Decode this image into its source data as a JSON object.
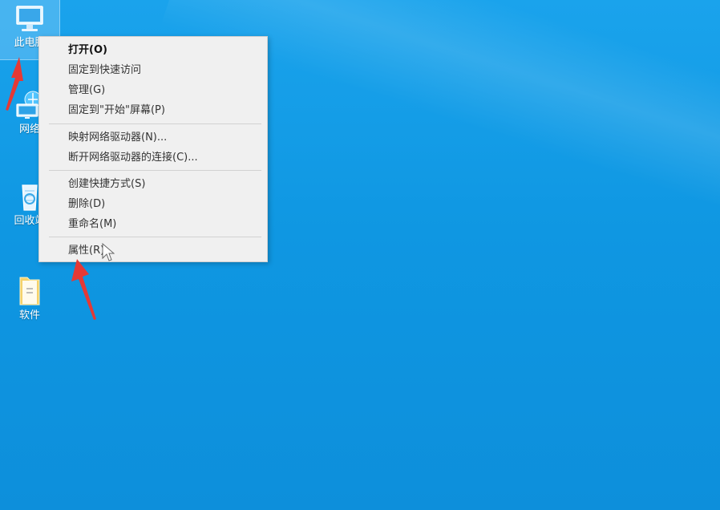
{
  "desktop": {
    "icons": [
      {
        "label": "此电脑",
        "icon": "computer-icon"
      },
      {
        "label": "网络",
        "icon": "network-icon"
      },
      {
        "label": "回收站",
        "icon": "recycle-bin-icon"
      },
      {
        "label": "软件",
        "icon": "folder-icon"
      }
    ]
  },
  "context_menu": {
    "items": [
      {
        "label": "打开(O)"
      },
      {
        "label": "固定到快速访问"
      },
      {
        "label": "管理(G)"
      },
      {
        "label": "固定到\"开始\"屏幕(P)"
      },
      {
        "label": "映射网络驱动器(N)..."
      },
      {
        "label": "断开网络驱动器的连接(C)..."
      },
      {
        "label": "创建快捷方式(S)"
      },
      {
        "label": "删除(D)"
      },
      {
        "label": "重命名(M)"
      },
      {
        "label": "属性(R)"
      }
    ]
  },
  "colors": {
    "desktop_blue": "#0f97e2",
    "menu_bg": "#f0f0f0",
    "annotation_arrow": "#e53935"
  }
}
